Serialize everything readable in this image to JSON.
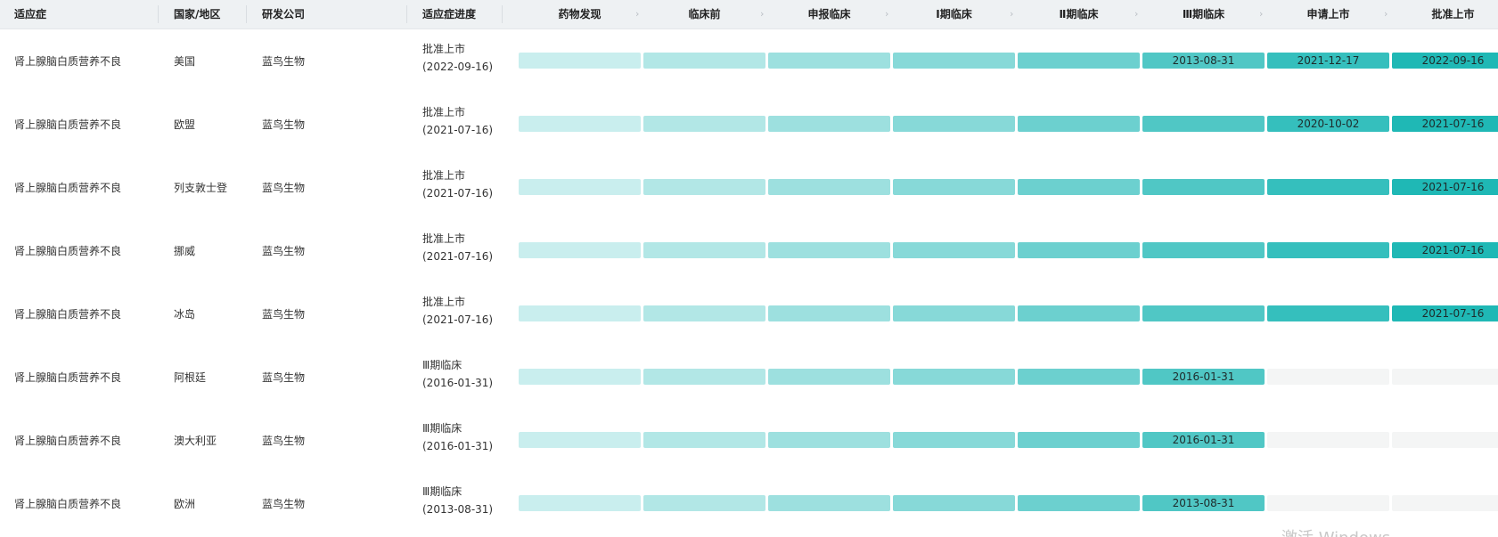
{
  "header": {
    "indication": "适应症",
    "country": "国家/地区",
    "company": "研发公司",
    "progress": "适应症进度",
    "stages": [
      "药物发现",
      "临床前",
      "申报临床",
      "Ⅰ期临床",
      "Ⅱ期临床",
      "Ⅲ期临床",
      "申请上市",
      "批准上市"
    ]
  },
  "rows": [
    {
      "indication": "肾上腺脑白质营养不良",
      "country": "美国",
      "company": "蓝鸟生物",
      "progress_status": "批准上市",
      "progress_date": "(2022-09-16)",
      "reached": 8,
      "dates": [
        "",
        "",
        "",
        "",
        "",
        "2013-08-31",
        "2021-12-17",
        "2022-09-16"
      ]
    },
    {
      "indication": "肾上腺脑白质营养不良",
      "country": "欧盟",
      "company": "蓝鸟生物",
      "progress_status": "批准上市",
      "progress_date": "(2021-07-16)",
      "reached": 8,
      "dates": [
        "",
        "",
        "",
        "",
        "",
        "",
        "2020-10-02",
        "2021-07-16"
      ]
    },
    {
      "indication": "肾上腺脑白质营养不良",
      "country": "列支敦士登",
      "company": "蓝鸟生物",
      "progress_status": "批准上市",
      "progress_date": "(2021-07-16)",
      "reached": 8,
      "dates": [
        "",
        "",
        "",
        "",
        "",
        "",
        "",
        "2021-07-16"
      ]
    },
    {
      "indication": "肾上腺脑白质营养不良",
      "country": "挪威",
      "company": "蓝鸟生物",
      "progress_status": "批准上市",
      "progress_date": "(2021-07-16)",
      "reached": 8,
      "dates": [
        "",
        "",
        "",
        "",
        "",
        "",
        "",
        "2021-07-16"
      ]
    },
    {
      "indication": "肾上腺脑白质营养不良",
      "country": "冰岛",
      "company": "蓝鸟生物",
      "progress_status": "批准上市",
      "progress_date": "(2021-07-16)",
      "reached": 8,
      "dates": [
        "",
        "",
        "",
        "",
        "",
        "",
        "",
        "2021-07-16"
      ]
    },
    {
      "indication": "肾上腺脑白质营养不良",
      "country": "阿根廷",
      "company": "蓝鸟生物",
      "progress_status": "Ⅲ期临床",
      "progress_date": "(2016-01-31)",
      "reached": 6,
      "dates": [
        "",
        "",
        "",
        "",
        "",
        "2016-01-31",
        "",
        ""
      ]
    },
    {
      "indication": "肾上腺脑白质营养不良",
      "country": "澳大利亚",
      "company": "蓝鸟生物",
      "progress_status": "Ⅲ期临床",
      "progress_date": "(2016-01-31)",
      "reached": 6,
      "dates": [
        "",
        "",
        "",
        "",
        "",
        "2016-01-31",
        "",
        ""
      ]
    },
    {
      "indication": "肾上腺脑白质营养不良",
      "country": "欧洲",
      "company": "蓝鸟生物",
      "progress_status": "Ⅲ期临床",
      "progress_date": "(2013-08-31)",
      "reached": 6,
      "dates": [
        "",
        "",
        "",
        "",
        "",
        "2013-08-31",
        "",
        ""
      ]
    }
  ],
  "watermark": "激活 Windows"
}
